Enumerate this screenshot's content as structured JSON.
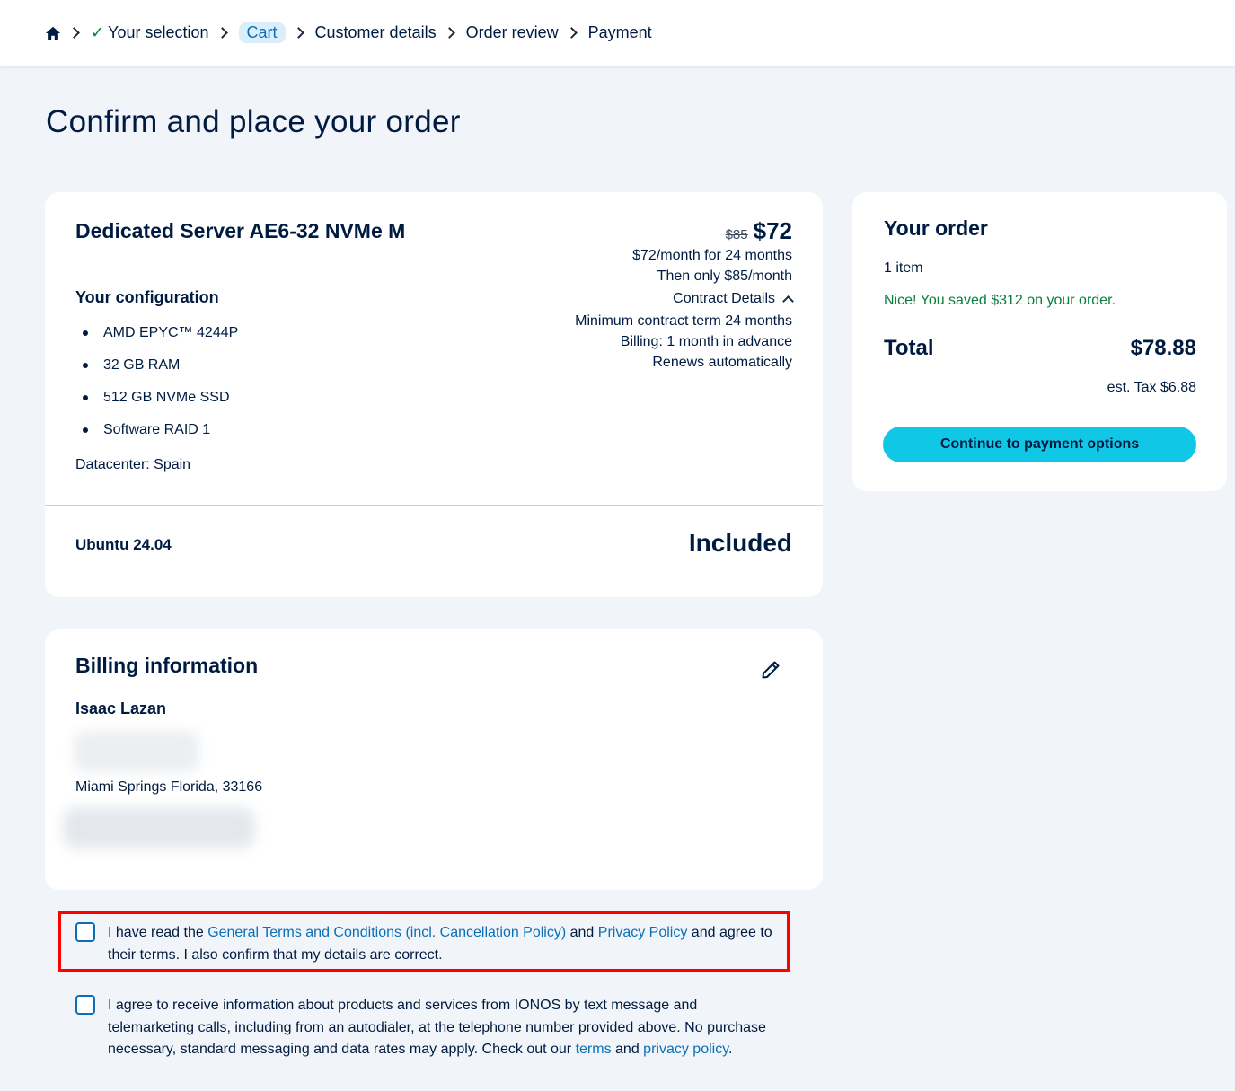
{
  "breadcrumb": {
    "home_icon": "home-icon",
    "items": [
      {
        "label": "Your selection",
        "state": "done"
      },
      {
        "label": "Cart",
        "state": "active"
      },
      {
        "label": "Customer details",
        "state": "upcoming"
      },
      {
        "label": "Order review",
        "state": "upcoming"
      },
      {
        "label": "Payment",
        "state": "upcoming"
      }
    ]
  },
  "page": {
    "title": "Confirm and place your order"
  },
  "product": {
    "name": "Dedicated Server AE6-32 NVMe M",
    "config_title": "Your configuration",
    "config_items": [
      "AMD EPYC™ 4244P",
      "32 GB RAM",
      "512 GB NVMe SSD",
      "Software RAID 1"
    ],
    "datacenter": "Datacenter: Spain",
    "old_price": "$85",
    "price": "$72",
    "price_detail": "$72/month for 24 months",
    "then_price": "Then only $85/month",
    "contract_link": "Contract Details",
    "contract_lines": [
      "Minimum contract term 24 months",
      "Billing: 1 month in advance",
      "Renews automatically"
    ],
    "os_name": "Ubuntu 24.04",
    "os_price": "Included"
  },
  "order": {
    "title": "Your order",
    "items": "1 item",
    "saved": "Nice! You saved $312 on your order.",
    "total_label": "Total",
    "total_value": "$78.88",
    "tax": "est. Tax $6.88",
    "button": "Continue to payment options"
  },
  "billing": {
    "title": "Billing information",
    "name": "Isaac Lazan",
    "city": "Miami Springs Florida, 33166"
  },
  "consents": {
    "terms": {
      "text1": "I have read the ",
      "link1": "General Terms and Conditions (incl. Cancellation Policy)",
      "text2": " and ",
      "link2": "Privacy Policy",
      "text3": " and agree to their terms. I also confirm that my details are correct."
    },
    "marketing": {
      "text1": "I agree to receive information about products and services from IONOS by text message and telemarketing calls, including from an autodialer, at the telephone number provided above. No purchase necessary, standard messaging and data rates may apply. Check out our ",
      "link1": "terms",
      "text2": " and ",
      "link2": "privacy policy",
      "text3": "."
    }
  },
  "colors": {
    "primary_text": "#001b41",
    "link": "#0b6fb8",
    "accent_button": "#11c7e6",
    "success": "#0a7d3c",
    "highlight": "#ff0000"
  }
}
